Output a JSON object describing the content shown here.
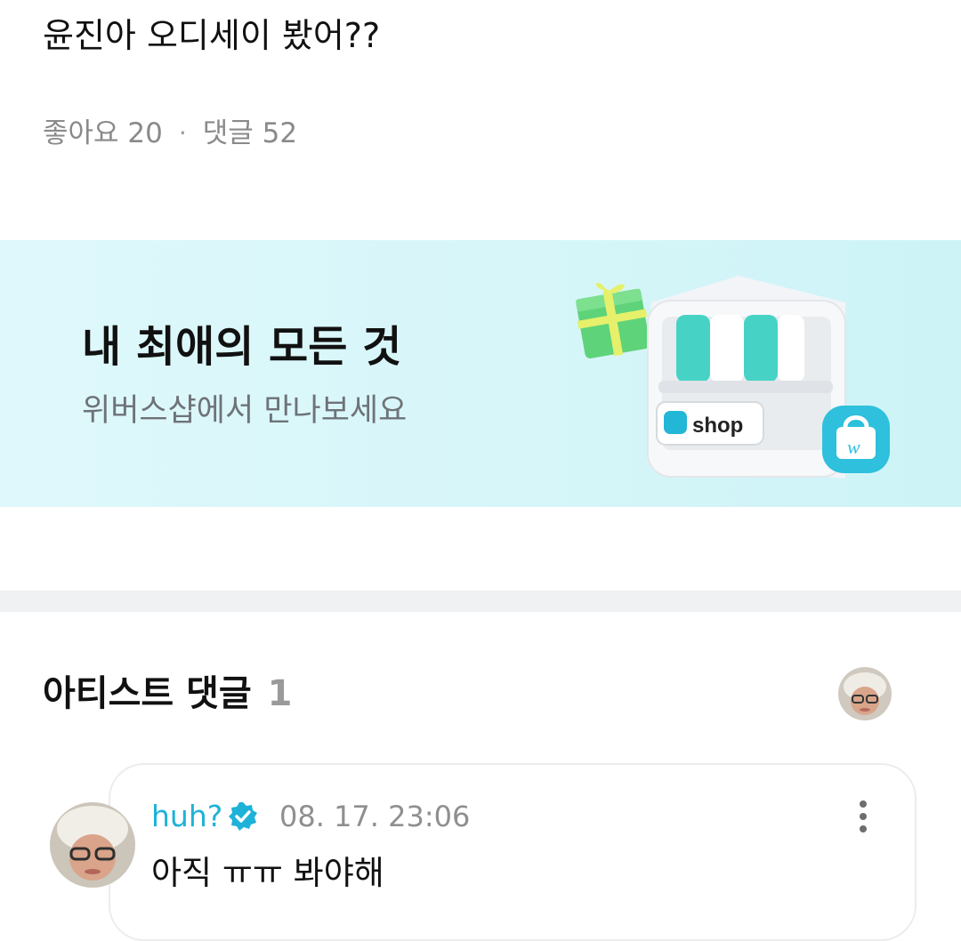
{
  "post": {
    "text": "윤진아 오디세이 봤어??",
    "likes_label": "좋아요 20",
    "dot": "·",
    "comments_label": "댓글 52"
  },
  "banner": {
    "title": "내 최애의 모든 것",
    "subtitle": "위버스샵에서 만나보세요",
    "shop_sign": "shop",
    "icons": [
      "gift-icon",
      "shop-building-icon",
      "weverse-bag-icon"
    ]
  },
  "artist_comments": {
    "title": "아티스트 댓글",
    "count": "1",
    "items": [
      {
        "author": "huh?",
        "verified": true,
        "timestamp": "08. 17. 23:06",
        "text": "아직 ㅠㅠ 봐야해"
      }
    ]
  },
  "colors": {
    "accent": "#1eb2d8",
    "banner_bg": "#d6f6f9",
    "muted_text": "#8a8a8a",
    "divider": "#f0f1f2"
  }
}
